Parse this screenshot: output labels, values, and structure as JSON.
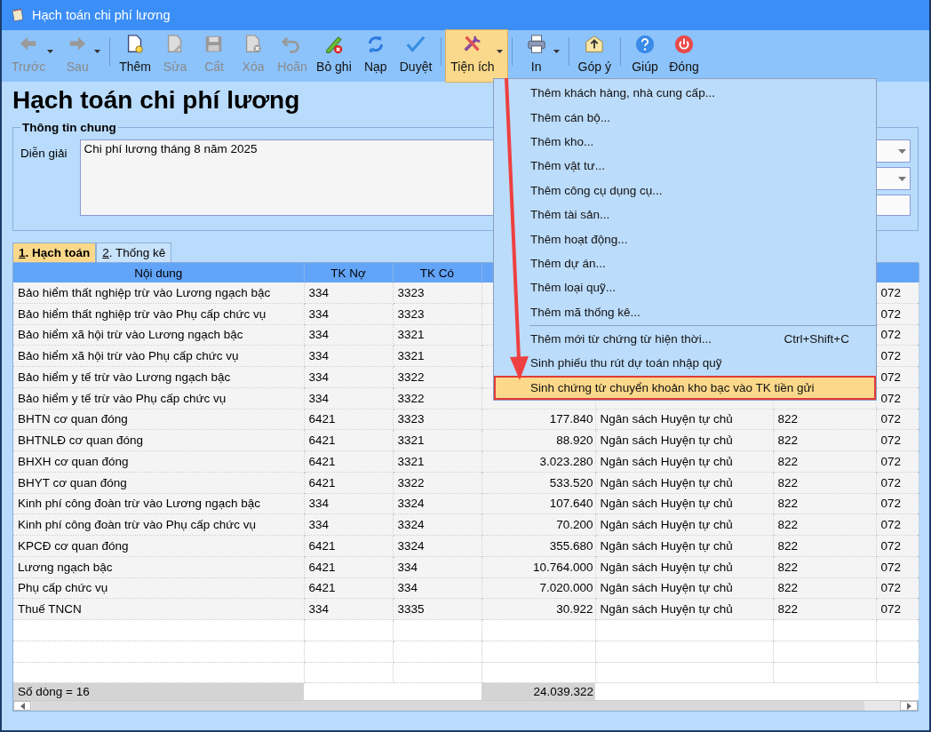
{
  "window": {
    "title": "Hạch toán chi phí lương"
  },
  "toolbar": {
    "groups": [
      [
        {
          "label": "Trước",
          "disabled": true,
          "dropdown": true,
          "selected": false
        },
        {
          "label": "Sau",
          "disabled": true,
          "dropdown": true,
          "selected": false
        }
      ],
      [
        {
          "label": "Thêm",
          "disabled": false,
          "dropdown": false,
          "selected": false
        },
        {
          "label": "Sửa",
          "disabled": true,
          "dropdown": false,
          "selected": false
        },
        {
          "label": "Cất",
          "disabled": true,
          "dropdown": false,
          "selected": false
        },
        {
          "label": "Xóa",
          "disabled": true,
          "dropdown": false,
          "selected": false
        },
        {
          "label": "Hoãn",
          "disabled": true,
          "dropdown": false,
          "selected": false
        },
        {
          "label": "Bỏ ghi",
          "disabled": false,
          "dropdown": false,
          "selected": false
        },
        {
          "label": "Nạp",
          "disabled": false,
          "dropdown": false,
          "selected": false
        },
        {
          "label": "Duyệt",
          "disabled": false,
          "dropdown": false,
          "selected": false
        }
      ],
      [
        {
          "label": "Tiện ích",
          "disabled": false,
          "dropdown": true,
          "selected": true
        }
      ],
      [
        {
          "label": "In",
          "disabled": false,
          "dropdown": true,
          "selected": false
        }
      ],
      [
        {
          "label": "Góp ý",
          "disabled": false,
          "dropdown": false,
          "selected": false
        }
      ],
      [
        {
          "label": "Giúp",
          "disabled": false,
          "dropdown": false,
          "selected": false
        },
        {
          "label": "Đóng",
          "disabled": false,
          "dropdown": false,
          "selected": false
        }
      ]
    ]
  },
  "page_title": "Hạch toán chi phí lương",
  "general_info": {
    "legend": "Thông tin chung",
    "description_label": "Diễn giải",
    "description": "Chi phí lương tháng 8 năm 2025"
  },
  "tabs": [
    {
      "label": "1. Hạch toán",
      "selected": true
    },
    {
      "label": "2. Thống kê",
      "selected": false
    }
  ],
  "table": {
    "columns": [
      "Nội dung",
      "TK Nợ",
      "TK Có"
    ],
    "rows": [
      {
        "content": "Bảo hiểm thất nghiệp trừ vào Lương ngạch bậc",
        "debit": "334",
        "credit": "3323",
        "column_7": "072"
      },
      {
        "content": "Bảo hiểm thất nghiệp trừ vào Phụ cấp chức vụ",
        "debit": "334",
        "credit": "3323",
        "column_7": "072"
      },
      {
        "content": "Bảo hiểm xã hội trừ vào Lương ngạch bậc",
        "debit": "334",
        "credit": "3321",
        "column_7": "072"
      },
      {
        "content": "Bảo hiểm xã hội trừ vào Phụ cấp chức vụ",
        "debit": "334",
        "credit": "3321",
        "column_7": "072"
      },
      {
        "content": "Bảo hiểm y tế trừ vào Lương ngạch bậc",
        "debit": "334",
        "credit": "3322",
        "column_7": "072"
      },
      {
        "content": "Bảo hiểm y tế trừ vào Phụ cấp chức vụ",
        "debit": "334",
        "credit": "3322",
        "column_7": "072"
      },
      {
        "content": "BHTN cơ quan đóng",
        "debit": "6421",
        "credit": "3323",
        "amount": "177.840",
        "source": "Ngân sách Huyện tự chủ",
        "column_6": "822",
        "column_7": "072"
      },
      {
        "content": "BHTNLĐ cơ quan đóng",
        "debit": "6421",
        "credit": "3321",
        "amount": "88.920",
        "source": "Ngân sách Huyện tự chủ",
        "column_6": "822",
        "column_7": "072"
      },
      {
        "content": "BHXH cơ quan đóng",
        "debit": "6421",
        "credit": "3321",
        "amount": "3.023.280",
        "source": "Ngân sách Huyện tự chủ",
        "column_6": "822",
        "column_7": "072"
      },
      {
        "content": "BHYT cơ quan đóng",
        "debit": "6421",
        "credit": "3322",
        "amount": "533.520",
        "source": "Ngân sách Huyện tự chủ",
        "column_6": "822",
        "column_7": "072"
      },
      {
        "content": "Kinh phí công đoàn trừ vào Lương ngạch bậc",
        "debit": "334",
        "credit": "3324",
        "amount": "107.640",
        "source": "Ngân sách Huyện tự chủ",
        "column_6": "822",
        "column_7": "072"
      },
      {
        "content": "Kinh phí công đoàn trừ vào Phụ cấp chức vụ",
        "debit": "334",
        "credit": "3324",
        "amount": "70.200",
        "source": "Ngân sách Huyện tự chủ",
        "column_6": "822",
        "column_7": "072"
      },
      {
        "content": "KPCĐ cơ quan đóng",
        "debit": "6421",
        "credit": "3324",
        "amount": "355.680",
        "source": "Ngân sách Huyện tự chủ",
        "column_6": "822",
        "column_7": "072"
      },
      {
        "content": "Lương ngạch bậc",
        "debit": "6421",
        "credit": "334",
        "amount": "10.764.000",
        "source": "Ngân sách Huyện tự chủ",
        "column_6": "822",
        "column_7": "072"
      },
      {
        "content": "Phụ cấp chức vụ",
        "debit": "6421",
        "credit": "334",
        "amount": "7.020.000",
        "source": "Ngân sách Huyện tự chủ",
        "column_6": "822",
        "column_7": "072"
      },
      {
        "content": "Thuế TNCN",
        "debit": "334",
        "credit": "3335",
        "amount": "30.922",
        "source": "Ngân sách Huyện tự chủ",
        "column_6": "822",
        "column_7": "072"
      }
    ],
    "footer": {
      "row_count": "Số dòng = 16",
      "total": "24.039.322"
    }
  },
  "menu": {
    "groups": [
      [
        {
          "label": "Thêm khách hàng, nhà cung cấp...",
          "selected": false
        },
        {
          "label": "Thêm cán bộ...",
          "selected": false
        },
        {
          "label": "Thêm kho...",
          "selected": false
        },
        {
          "label": "Thêm vật tư...",
          "selected": false
        },
        {
          "label": "Thêm công cụ dụng cụ...",
          "selected": false
        },
        {
          "label": "Thêm tài sản...",
          "selected": false
        },
        {
          "label": "Thêm hoạt động...",
          "selected": false
        },
        {
          "label": "Thêm dự án...",
          "selected": false
        },
        {
          "label": "Thêm loại quỹ...",
          "selected": false
        },
        {
          "label": "Thêm mã thống kê...",
          "selected": false
        }
      ],
      [
        {
          "label": "Thêm mới từ chứng từ hiện thời...",
          "shortcut": "Ctrl+Shift+C",
          "selected": false
        },
        {
          "label": "Sinh phiếu thu rút dự toán nhập quỹ",
          "selected": false
        },
        {
          "label": "Sinh chứng từ chuyển khoản kho bạc vào TK tiền gửi",
          "selected": true
        }
      ]
    ]
  }
}
